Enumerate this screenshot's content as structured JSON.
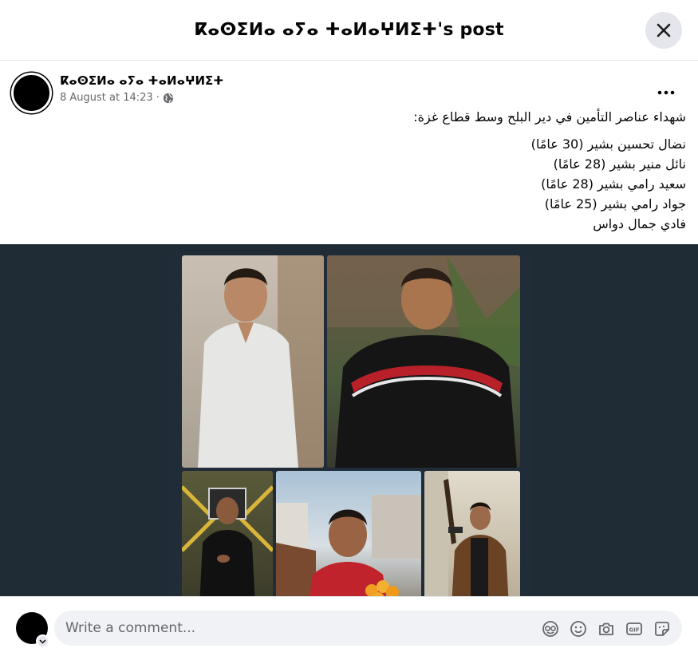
{
  "header": {
    "title": "ⴽⴰⵙⵉⵍⴰ ⴰⵢⴰ ⵜⴰⵍⴰⵖⵍⵉⵜ's post",
    "close_icon": "close-icon"
  },
  "post": {
    "author_name": "ⴽⴰⵙⵉⵍⴰ ⴰⵢⴰ ⵜⴰⵍⴰⵖⵍⵉⵜ",
    "timestamp": "8 August at 14:23",
    "separator": "·",
    "audience_icon": "globe-icon",
    "more_icon": "more-dots-icon",
    "text_title": "شهداء عناصر التأمين في دير البلح وسط قطاع غزة:",
    "text_lines": [
      "نضال تحسين بشير (30 عامًا)",
      "نائل منير بشير (28 عامًا)",
      "سعيد رامي بشير (28 عامًا)",
      "جواد رامي بشير (25 عامًا)",
      "فادي جمال دواس"
    ]
  },
  "composer": {
    "placeholder": "Write a comment...",
    "icons": [
      "avatar-sticker-icon",
      "emoji-icon",
      "camera-icon",
      "gif-icon",
      "sticker-icon"
    ]
  },
  "colors": {
    "media_background": "#1f2b35",
    "input_background": "#f0f2f5",
    "secondary_text": "#65676b",
    "close_button_bg": "#e4e6eb"
  }
}
